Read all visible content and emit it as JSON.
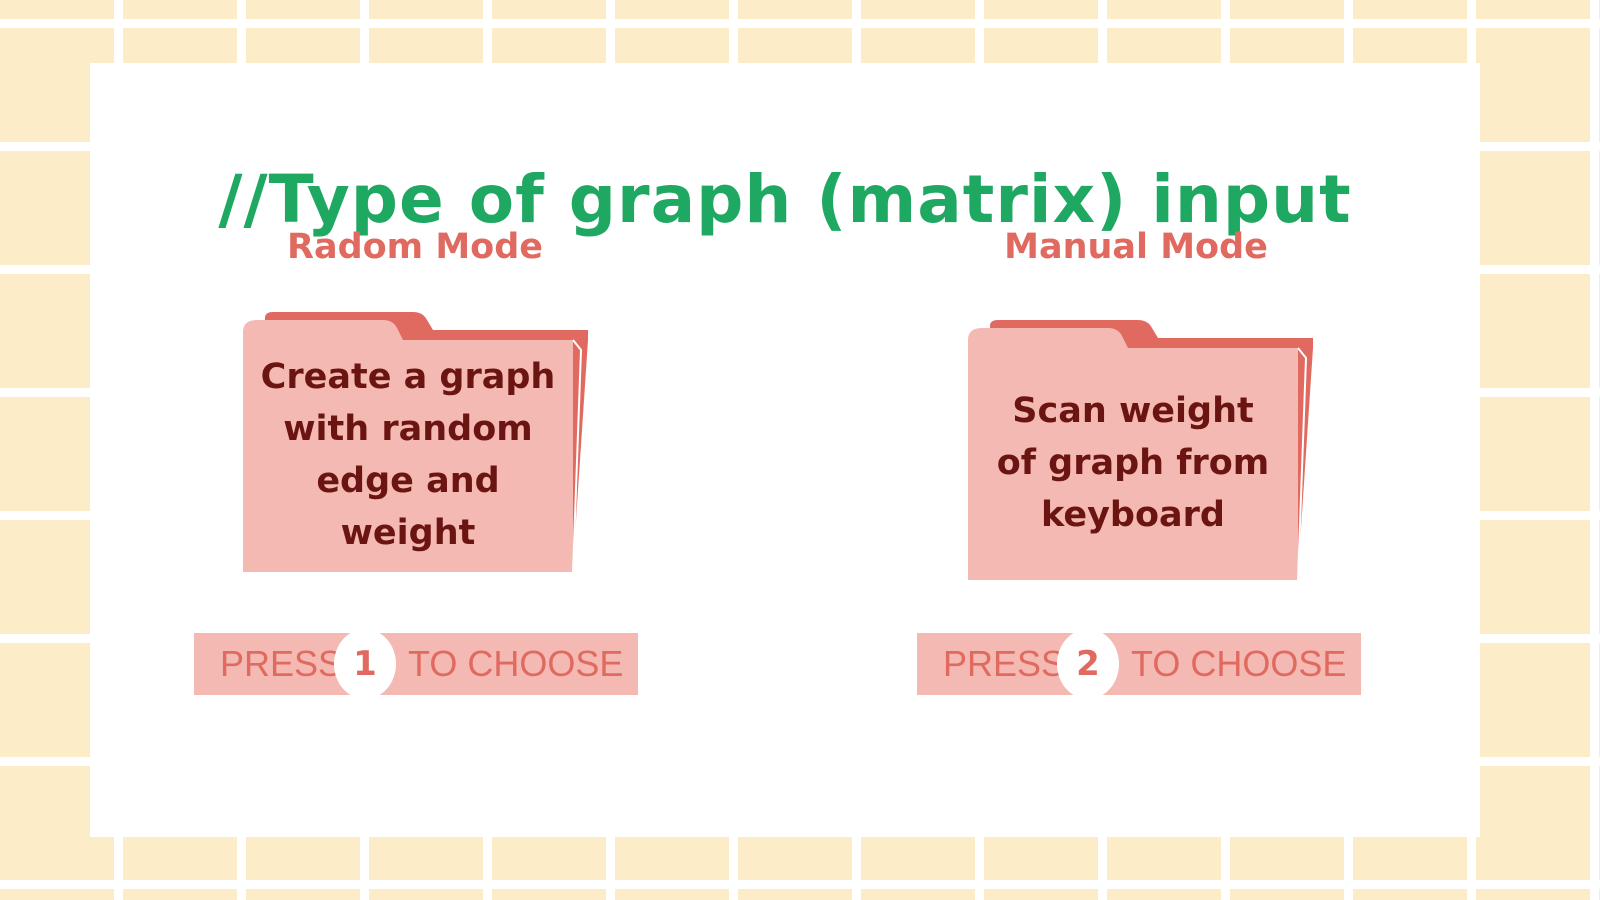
{
  "title": "//Type of graph (matrix) input",
  "modes": [
    {
      "label": "Radom Mode",
      "description": "Create a graph\nwith random\nedge and\nweight",
      "press": {
        "word": "PRESS",
        "key": "1",
        "rest": "TO CHOOSE"
      }
    },
    {
      "label": "Manual Mode",
      "description": "Scan weight\nof graph from\nkeyboard",
      "press": {
        "word": "PRESS",
        "key": "2",
        "rest": "TO CHOOSE"
      }
    }
  ],
  "colors": {
    "title": "#1fa862",
    "accent": "#e06a5f",
    "folder_front": "#f5b9b4",
    "folder_back": "#e06a5f",
    "folder_text": "#6b1512",
    "background_tile": "#fdecc8"
  }
}
